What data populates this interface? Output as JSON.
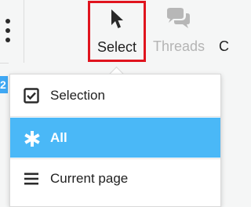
{
  "toolbar": {
    "more_icon": "kebab-vertical-icon",
    "buttons": [
      {
        "label": "Select",
        "icon": "cursor-arrow-icon",
        "highlighted": true
      },
      {
        "label": "Threads",
        "icon": "chat-bubbles-icon",
        "disabled": true
      },
      {
        "label": "C",
        "icon": ""
      }
    ]
  },
  "left_badge": "2",
  "dropdown": {
    "items": [
      {
        "label": "Selection",
        "icon": "checkbox-checked-icon",
        "active": false
      },
      {
        "label": "All",
        "icon": "asterisk-icon",
        "active": true
      },
      {
        "label": "Current page",
        "icon": "list-lines-icon",
        "active": false
      }
    ]
  },
  "colors": {
    "highlight_border": "#e0141e",
    "active_item_bg": "#4ab8f7",
    "disabled_text": "#b4b4b4",
    "toolbar_bg": "#f5f6f6"
  }
}
